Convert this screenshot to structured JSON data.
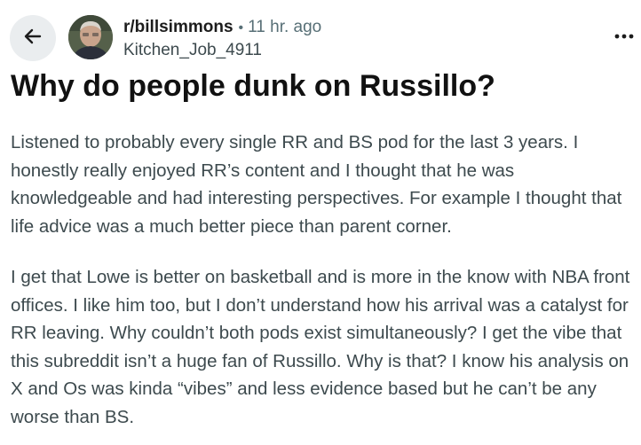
{
  "header": {
    "back_icon": "arrow-left-icon",
    "subreddit": "r/billsimmons",
    "separator": "•",
    "time": "11 hr. ago",
    "author": "Kitchen_Job_4911",
    "more_icon": "more-horizontal-icon"
  },
  "post": {
    "title": "Why do people dunk on Russillo?",
    "paragraphs": [
      "Listened to probably every single RR and BS pod for the last 3 years. I honestly really enjoyed RR’s content and I thought that he was knowledgeable and had interesting perspectives. For example I thought that life advice was a much better piece than parent corner.",
      "I get that Lowe is better on basketball and is more in the know with NBA front offices. I like him too, but I don’t understand how his arrival was a catalyst for RR leaving. Why couldn’t both pods exist simultaneously? I get the vibe that this subreddit isn’t a huge fan of Russillo. Why is that? I know his analysis on X and Os was kinda “vibes” and less evidence based but he can’t be any worse than BS."
    ]
  },
  "colors": {
    "back_button_bg": "#eaedef",
    "title": "#111111",
    "body_text": "#3d4a4e",
    "secondary_text": "#576f76"
  }
}
